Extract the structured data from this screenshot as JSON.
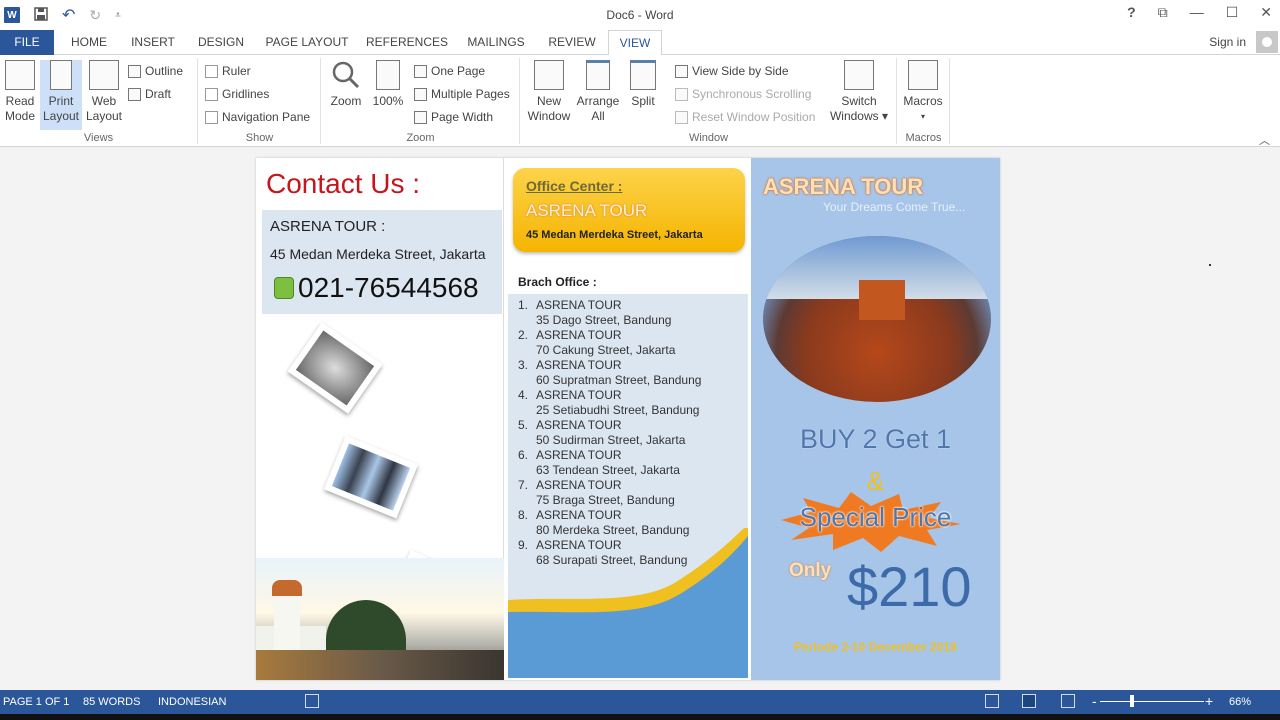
{
  "window": {
    "title": "Doc6 - Word",
    "controls": {
      "help": "?",
      "ribbon_display": "⧉",
      "minimize": "—",
      "maximize": "☐",
      "close": "✕"
    }
  },
  "quick_access": {
    "app_icon": "W",
    "save": "save-icon",
    "undo": "↶",
    "redo": "↻",
    "customize": "⩡"
  },
  "tabs": [
    {
      "label": "FILE"
    },
    {
      "label": "HOME"
    },
    {
      "label": "INSERT"
    },
    {
      "label": "DESIGN"
    },
    {
      "label": "PAGE LAYOUT"
    },
    {
      "label": "REFERENCES"
    },
    {
      "label": "MAILINGS"
    },
    {
      "label": "REVIEW"
    },
    {
      "label": "VIEW"
    }
  ],
  "active_tab": "VIEW",
  "account": {
    "sign_in": "Sign in"
  },
  "ribbon": {
    "views": {
      "label": "Views",
      "read_mode": "Read Mode",
      "read_mode_l1": "Read",
      "read_mode_l2": "Mode",
      "print_layout_l1": "Print",
      "print_layout_l2": "Layout",
      "web_layout_l1": "Web",
      "web_layout_l2": "Layout",
      "outline": "Outline",
      "draft": "Draft",
      "selected": "Print Layout"
    },
    "show": {
      "label": "Show",
      "ruler": "Ruler",
      "gridlines": "Gridlines",
      "navigation_pane": "Navigation Pane",
      "ruler_checked": false,
      "gridlines_checked": false,
      "navigation_pane_checked": false
    },
    "zoom": {
      "label": "Zoom",
      "zoom": "Zoom",
      "hundred": "100%",
      "one_page": "One Page",
      "multiple_pages": "Multiple Pages",
      "page_width": "Page Width"
    },
    "window": {
      "label": "Window",
      "new_window_l1": "New",
      "new_window_l2": "Window",
      "arrange_all_l1": "Arrange",
      "arrange_all_l2": "All",
      "split": "Split",
      "view_side_by_side": "View Side by Side",
      "synchronous_scrolling": "Synchronous Scrolling",
      "reset_window_position": "Reset Window Position",
      "switch_windows_l1": "Switch",
      "switch_windows_l2": "Windows ▾"
    },
    "macros": {
      "label": "Macros",
      "macros": "Macros",
      "dropdown": "▾"
    }
  },
  "document": {
    "contact": {
      "title": "Contact Us :",
      "company": "ASRENA TOUR :",
      "address": "45 Medan Merdeka Street, Jakarta",
      "phone": "021-76544568"
    },
    "office_center": {
      "title": "Office Center :",
      "name": "ASRENA TOUR",
      "address": "45 Medan Merdeka Street, Jakarta"
    },
    "branch": {
      "title": "Brach Office :",
      "items": [
        {
          "num": "1.",
          "name": "ASRENA TOUR",
          "address": "35 Dago Street, Bandung"
        },
        {
          "num": "2.",
          "name": "ASRENA TOUR",
          "address": "70 Cakung Street, Jakarta"
        },
        {
          "num": "3.",
          "name": "ASRENA TOUR",
          "address": "60 Supratman Street, Bandung"
        },
        {
          "num": "4.",
          "name": "ASRENA TOUR",
          "address": "25 Setiabudhi Street, Bandung"
        },
        {
          "num": "5.",
          "name": "ASRENA TOUR",
          "address": "50 Sudirman Street, Jakarta"
        },
        {
          "num": "6.",
          "name": "ASRENA TOUR",
          "address": "63 Tendean Street, Jakarta"
        },
        {
          "num": "7.",
          "name": "ASRENA TOUR",
          "address": "75 Braga Street, Bandung"
        },
        {
          "num": "8.",
          "name": "ASRENA TOUR",
          "address": "80 Merdeka Street, Bandung"
        },
        {
          "num": "9.",
          "name": "ASRENA TOUR",
          "address": "68 Surapati Street, Bandung"
        }
      ]
    },
    "promo": {
      "brand": "ASRENA TOUR",
      "tagline": "Your Dreams Come True...",
      "offer": "BUY 2 Get 1",
      "ampersand": "&",
      "special": "Special Price",
      "only": "Only",
      "price": "$210",
      "period": "Periode 2-10 December 2018"
    }
  },
  "status": {
    "page": "PAGE 1 OF 1",
    "words": "85 WORDS",
    "language": "INDONESIAN",
    "zoom_minus": "-",
    "zoom_plus": "+",
    "zoom_level": "66%",
    "zoom_percent": 66
  },
  "colors": {
    "accent": "#2b579a",
    "contact_title": "#c4161c",
    "office_box": "#f5b400",
    "promo_bg": "#a7c5e8",
    "price": "#3d6aa8"
  }
}
